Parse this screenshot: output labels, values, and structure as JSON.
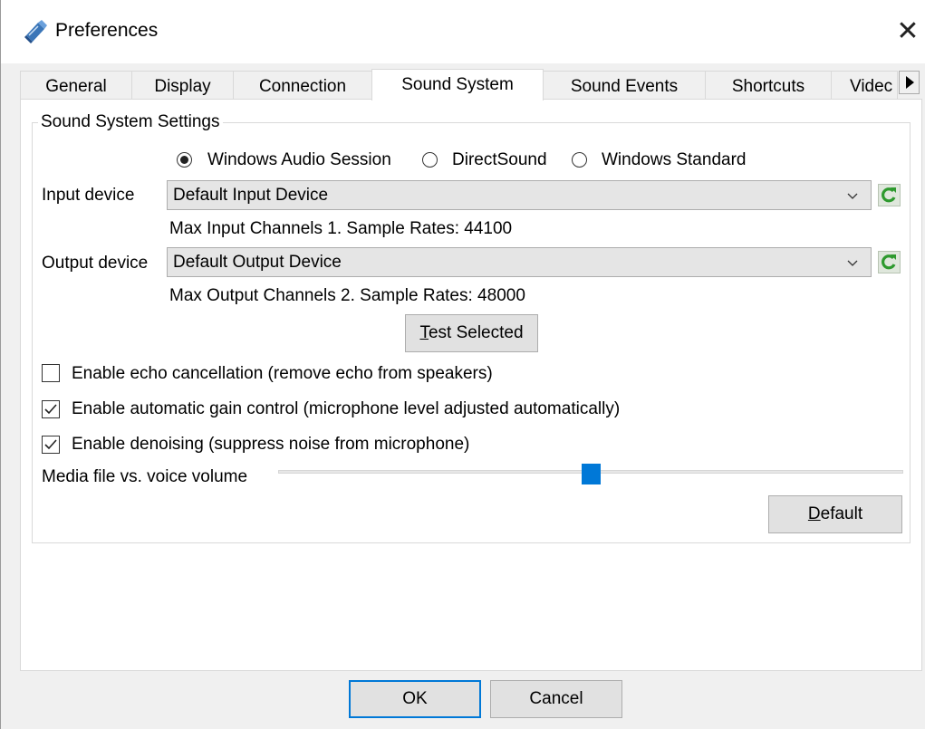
{
  "window": {
    "title": "Preferences",
    "close_symbol": "✕",
    "icons": {
      "app": "app-logo-icon",
      "close": "close-icon"
    }
  },
  "tabs": [
    {
      "label": "General",
      "active": false
    },
    {
      "label": "Display",
      "active": false
    },
    {
      "label": "Connection",
      "active": false
    },
    {
      "label": "Sound System",
      "active": true
    },
    {
      "label": "Sound Events",
      "active": false
    },
    {
      "label": "Shortcuts",
      "active": false
    },
    {
      "label": "Videc",
      "active": false
    }
  ],
  "sound_system": {
    "group_title": "Sound System Settings",
    "api_options": [
      {
        "label": "Windows Audio Session",
        "selected": true
      },
      {
        "label": "DirectSound",
        "selected": false
      },
      {
        "label": "Windows Standard",
        "selected": false
      }
    ],
    "input": {
      "label": "Input device",
      "value": "Default Input Device",
      "info": "Max Input Channels 1. Sample Rates: 44100"
    },
    "output": {
      "label": "Output device",
      "value": "Default Output Device",
      "info": "Max Output Channels 2. Sample Rates: 48000"
    },
    "test_button": {
      "label": "Test Selected",
      "mnemonic": "T",
      "rest": "est Selected"
    },
    "checkboxes": [
      {
        "label": "Enable echo cancellation (remove echo from speakers)",
        "checked": false
      },
      {
        "label": "Enable automatic gain control (microphone level adjusted automatically)",
        "checked": true
      },
      {
        "label": "Enable denoising (suppress noise from microphone)",
        "checked": true
      }
    ],
    "volume": {
      "label": "Media file vs. voice volume",
      "value_fraction": 0.5
    },
    "default_button": {
      "label": "Default",
      "mnemonic": "D",
      "rest": "efault"
    }
  },
  "dialog_buttons": {
    "ok": "OK",
    "cancel": "Cancel"
  },
  "colors": {
    "accent": "#0078d7",
    "refresh_green": "#2e9a2e",
    "client_bg": "#f0f0f0"
  }
}
